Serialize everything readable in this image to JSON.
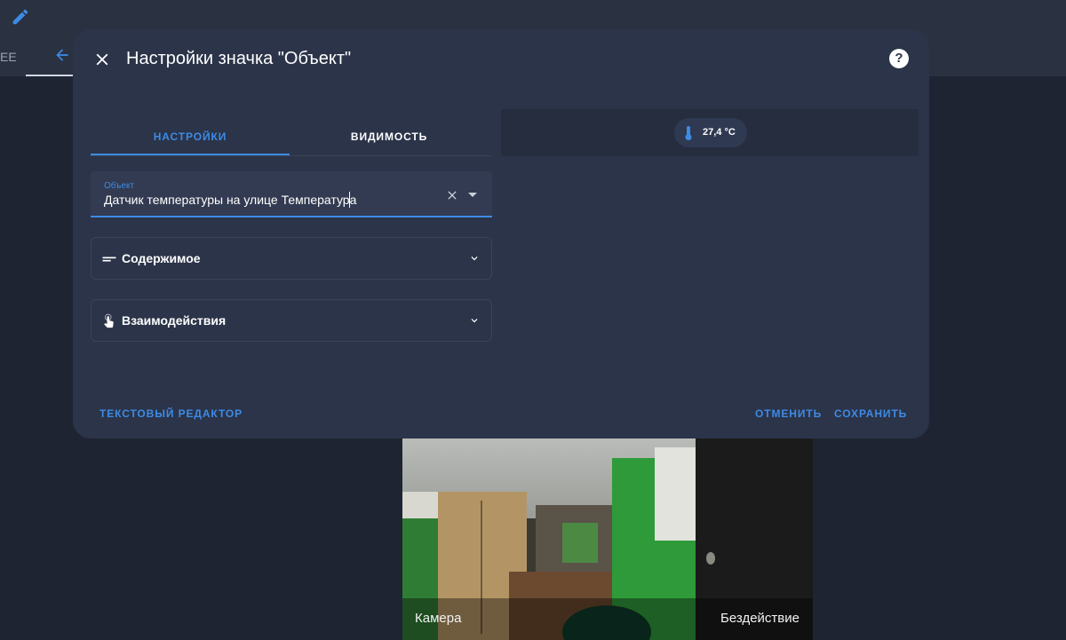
{
  "background": {
    "tab_text": "EE",
    "camera": {
      "name": "Камера",
      "state": "Бездействие"
    }
  },
  "dialog": {
    "title": "Настройки значка \"Объект\"",
    "help_label": "?",
    "tabs": [
      {
        "label": "НАСТРОЙКИ",
        "active": true
      },
      {
        "label": "ВИДИМОСТЬ",
        "active": false
      }
    ],
    "entity_field": {
      "label": "Объект",
      "value": "Датчик температуры на улице Температура"
    },
    "panels": [
      {
        "title": "Содержимое",
        "icon": "text-short-icon"
      },
      {
        "title": "Взаимодействия",
        "icon": "gesture-tap-icon"
      }
    ],
    "preview": {
      "badge_value": "27,4 °C",
      "badge_icon": "thermometer-icon"
    },
    "footer": {
      "text_editor_label": "ТЕКСТОВЫЙ РЕДАКТОР",
      "cancel_label": "ОТМЕНИТЬ",
      "save_label": "СОХРАНИТЬ"
    }
  },
  "colors": {
    "accent": "#3d8be6",
    "dialog_bg": "#2b3449",
    "page_bg": "#1f2433"
  }
}
